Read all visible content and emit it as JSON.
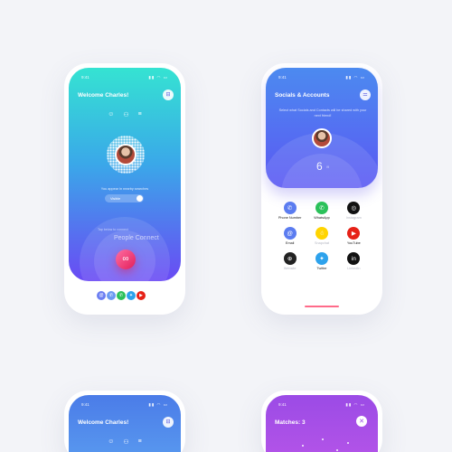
{
  "colors": {
    "page_bg": "#f3f4f8",
    "accent_pink": "#e21f5a",
    "accent_blue": "#5b58f3"
  },
  "phone1": {
    "status_time": "9:41",
    "title": "Welcome Charles!",
    "visible_text": "You appear in nearby searches",
    "toggle_label": "Visible",
    "connect_hint": "Tap below to connect",
    "connect_label": "People Connect",
    "top_icons": [
      "user-icon",
      "people-icon",
      "list-icon"
    ],
    "dock_icons": [
      "email-icon",
      "phone-icon",
      "whatsapp-icon",
      "twitter-icon",
      "youtube-icon"
    ]
  },
  "phone2": {
    "status_time": "9:41",
    "title": "Socials & Accounts",
    "subtitle": "Select what Socials and Contacts will be shared with your next friend!",
    "count": "6",
    "count_unit": "/9",
    "accounts": [
      {
        "label": "Phone Number",
        "icon": "phone-icon",
        "color": "#5b7cf0",
        "enabled": true
      },
      {
        "label": "WhatsApp",
        "icon": "whatsapp-icon",
        "color": "#2bc15a",
        "enabled": true
      },
      {
        "label": "Instagram",
        "icon": "instagram-icon",
        "color": "#111111",
        "enabled": false
      },
      {
        "label": "Email",
        "icon": "email-icon",
        "color": "#5b7cf0",
        "enabled": true
      },
      {
        "label": "Snapchat",
        "icon": "snapchat-icon",
        "color": "#ffd400",
        "enabled": false
      },
      {
        "label": "YouTube",
        "icon": "youtube-icon",
        "color": "#e62117",
        "enabled": true
      },
      {
        "label": "Website",
        "icon": "globe-icon",
        "color": "#222222",
        "enabled": false
      },
      {
        "label": "Twitter",
        "icon": "twitter-icon",
        "color": "#2da2ec",
        "enabled": true
      },
      {
        "label": "LinkedIn",
        "icon": "linkedin-icon",
        "color": "#111111",
        "enabled": false
      }
    ]
  },
  "phone3": {
    "status_time": "9:41",
    "title": "Welcome Charles!"
  },
  "phone4": {
    "status_time": "9:41",
    "title": "Matches: 3"
  }
}
